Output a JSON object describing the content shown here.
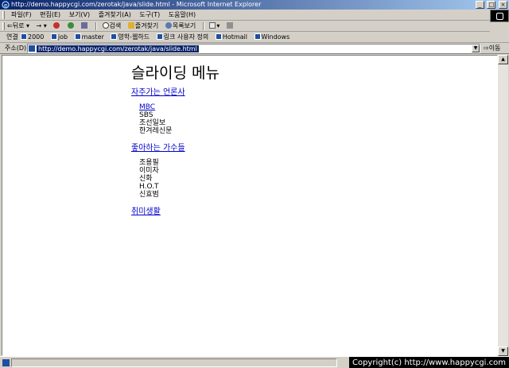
{
  "window": {
    "title": "http://demo.happycgi.com/zerotak/java/slide.html - Microsoft Internet Explorer",
    "controls": [
      "_",
      "□",
      "×"
    ]
  },
  "menubar": {
    "items": [
      "파일(F)",
      "편집(E)",
      "보기(V)",
      "즐겨찾기(A)",
      "도구(T)",
      "도움말(H)"
    ]
  },
  "toolbar": {
    "back": "뒤로",
    "forward": "→",
    "search": "검색",
    "favorites": "즐겨찾기",
    "history": "목록보기"
  },
  "links": {
    "label": "연결",
    "items": [
      "2000",
      "job",
      "master",
      "영학-웹하드",
      "링크 사용자 정의",
      "Hotmail",
      "Windows"
    ]
  },
  "address": {
    "label": "주소(D)",
    "url": "http://demo.happycgi.com/zerotak/java/slide.html",
    "go_label": "이동"
  },
  "page": {
    "title": "슬라이딩 메뉴",
    "categories": [
      {
        "label": "자주가는 언론사",
        "items": [
          "MBC",
          "SBS",
          "조선일보",
          "한겨레신문"
        ]
      },
      {
        "label": "좋아하는 가수들",
        "items": [
          "조용필",
          "이미자",
          "신화",
          "H.O.T",
          "신효범"
        ]
      },
      {
        "label": "취미생활",
        "items": []
      }
    ]
  },
  "status": {
    "copyright": "Copyright(c) http://www.happycgi.com"
  },
  "colors": {
    "titlebar": "#0a246a",
    "link": "#0000cc",
    "chrome": "#d4d0c8"
  }
}
